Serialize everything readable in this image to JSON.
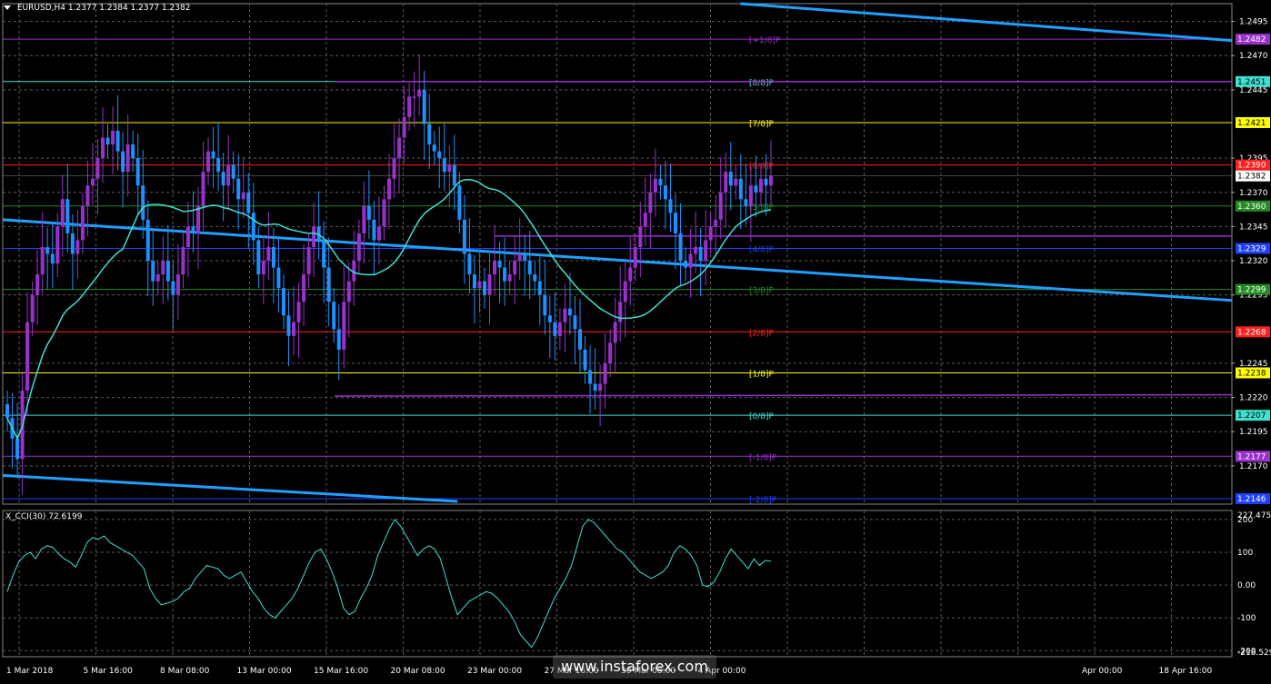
{
  "header": {
    "symbol": "EURUSD,H4",
    "ohlc": "1.2377 1.2384 1.2377 1.2382"
  },
  "indicator": {
    "title": "X_CCI(30) 72.6199",
    "ymax_label": "227.4755",
    "ymin_label": "-218.529"
  },
  "watermark": "www.instaforex.com",
  "colors": {
    "background": "#000000",
    "bull_candle": "#9932cc",
    "bear_candle": "#1e90ff",
    "ma_line": "#40e0d0",
    "trend_channel": "#1fa0ff",
    "cci_line": "#40e0d0",
    "grid": "#5a5a5a"
  },
  "chart_data": [
    {
      "type": "candlestick",
      "title": "EURUSD,H4",
      "x_tick_labels": [
        "1 Mar 2018",
        "5 Mar 16:00",
        "8 Mar 08:00",
        "13 Mar 00:00",
        "15 Mar 16:00",
        "20 Mar 08:00",
        "23 Mar 00:00",
        "27 Mar 16:00",
        "30 Mar 08:00",
        "4 Apr 00:00",
        "",
        "",
        "",
        "",
        "Apr 00:00",
        "18 Apr 16:00"
      ],
      "y_ticks": [
        1.2495,
        1.247,
        1.2445,
        1.2395,
        1.237,
        1.2345,
        1.232,
        1.2295,
        1.2245,
        1.222,
        1.2195,
        1.217
      ],
      "ylim": [
        1.2142,
        1.2508
      ],
      "current_price": 1.2382,
      "closes": [
        1.2205,
        1.219,
        1.2175,
        1.2225,
        1.2275,
        1.2295,
        1.231,
        1.233,
        1.2325,
        1.2318,
        1.2345,
        1.2365,
        1.234,
        1.2325,
        1.2335,
        1.236,
        1.2375,
        1.238,
        1.2395,
        1.241,
        1.2405,
        1.2415,
        1.24,
        1.2385,
        1.2405,
        1.2395,
        1.2375,
        1.235,
        1.232,
        1.2305,
        1.231,
        1.232,
        1.2305,
        1.2295,
        1.231,
        1.233,
        1.2345,
        1.234,
        1.236,
        1.2385,
        1.24,
        1.2395,
        1.2385,
        1.2375,
        1.239,
        1.238,
        1.2365,
        1.237,
        1.2355,
        1.2335,
        1.231,
        1.232,
        1.233,
        1.2315,
        1.23,
        1.228,
        1.2265,
        1.2275,
        1.229,
        1.231,
        1.233,
        1.2345,
        1.2335,
        1.2315,
        1.229,
        1.227,
        1.2255,
        1.229,
        1.2305,
        1.232,
        1.234,
        1.236,
        1.235,
        1.2335,
        1.2345,
        1.2365,
        1.238,
        1.2395,
        1.241,
        1.2425,
        1.244,
        1.244,
        1.2445,
        1.242,
        1.2405,
        1.24,
        1.2395,
        1.2385,
        1.239,
        1.2375,
        1.235,
        1.2325,
        1.231,
        1.23,
        1.2305,
        1.2295,
        1.231,
        1.232,
        1.2315,
        1.2305,
        1.231,
        1.232,
        1.2325,
        1.232,
        1.231,
        1.2305,
        1.2295,
        1.228,
        1.2275,
        1.2265,
        1.2275,
        1.2285,
        1.228,
        1.227,
        1.2255,
        1.224,
        1.223,
        1.2225,
        1.223,
        1.2245,
        1.226,
        1.2275,
        1.229,
        1.2305,
        1.2315,
        1.233,
        1.2345,
        1.2355,
        1.237,
        1.238,
        1.2375,
        1.2365,
        1.2355,
        1.234,
        1.232,
        1.2315,
        1.2325,
        1.233,
        1.232,
        1.2335,
        1.2345,
        1.235,
        1.237,
        1.2385,
        1.2375,
        1.238,
        1.2365,
        1.236,
        1.2375,
        1.237,
        1.238,
        1.2375,
        1.2382
      ],
      "ma_period": 24,
      "horizontal_levels": [
        {
          "label": "[+1/8]P",
          "price": 1.2482,
          "color": "#9932cc"
        },
        {
          "label": "[8/8]P",
          "price": 1.2451,
          "color": "#40e0d0"
        },
        {
          "label": "[7/8]P",
          "price": 1.2421,
          "color": "#ffff00"
        },
        {
          "label": "[6/8]P",
          "price": 1.239,
          "color": "#ff2020"
        },
        {
          "label": "[5/8]P",
          "price": 1.236,
          "color": "#228b22"
        },
        {
          "label": "[4/8]P",
          "price": 1.2329,
          "color": "#2040ff"
        },
        {
          "label": "[3/8]P",
          "price": 1.2299,
          "color": "#228b22"
        },
        {
          "label": "[2/8]P",
          "price": 1.2268,
          "color": "#ff2020"
        },
        {
          "label": "[1/8]P",
          "price": 1.2238,
          "color": "#ffff00"
        },
        {
          "label": "[0/8]P",
          "price": 1.2207,
          "color": "#40e0d0"
        },
        {
          "label": "[-1/8]P",
          "price": 1.2177,
          "color": "#9932cc"
        },
        {
          "label": "[-2/8]P",
          "price": 1.2146,
          "color": "#2040ff"
        }
      ],
      "level_price_labels": [
        "1.2482",
        "1.2451",
        "1.2421",
        "1.2390",
        "1.2360",
        "1.2329",
        "1.2299",
        "1.2268",
        "1.2238",
        "1.2207",
        "1.2177",
        "1.2146"
      ],
      "trend_lines": [
        {
          "from": [
            0,
            1.235
          ],
          "to": [
            1,
            1.2291
          ],
          "color": "#1fa0ff"
        },
        {
          "from": [
            0.6,
            1.2508
          ],
          "to": [
            1,
            1.2481
          ],
          "color": "#1fa0ff"
        },
        {
          "from": [
            0,
            1.2163
          ],
          "to": [
            0.37,
            1.2144
          ],
          "color": "#1fa0ff"
        },
        {
          "from": [
            0.27,
            1.2451
          ],
          "to": [
            1,
            1.2451
          ],
          "color": "#9932cc"
        },
        {
          "from": [
            0.27,
            1.2221
          ],
          "to": [
            1,
            1.2222
          ],
          "color": "#9932cc"
        },
        {
          "from": [
            0.4,
            1.2338
          ],
          "to": [
            1,
            1.2338
          ],
          "color": "#9932cc"
        }
      ]
    },
    {
      "type": "line",
      "title": "X_CCI(30) 72.6199",
      "y_ticks": [
        200,
        100,
        0.0,
        -100,
        -200
      ],
      "ylim": [
        -218.529,
        227.4755
      ],
      "values": [
        -20,
        30,
        70,
        90,
        100,
        80,
        110,
        120,
        115,
        95,
        80,
        70,
        55,
        90,
        130,
        145,
        140,
        150,
        130,
        120,
        110,
        100,
        90,
        70,
        50,
        -10,
        -40,
        -60,
        -55,
        -50,
        -40,
        -20,
        -10,
        20,
        40,
        60,
        55,
        50,
        30,
        20,
        30,
        40,
        10,
        -20,
        -40,
        -70,
        -90,
        -100,
        -80,
        -60,
        -40,
        -10,
        30,
        70,
        100,
        110,
        80,
        40,
        -10,
        -70,
        -90,
        -80,
        -40,
        -10,
        30,
        90,
        130,
        170,
        200,
        180,
        150,
        120,
        90,
        110,
        120,
        110,
        80,
        20,
        -40,
        -90,
        -70,
        -50,
        -40,
        -30,
        -20,
        -25,
        -40,
        -60,
        -80,
        -110,
        -150,
        -170,
        -190,
        -160,
        -120,
        -80,
        -40,
        -10,
        20,
        60,
        120,
        180,
        200,
        190,
        170,
        150,
        130,
        110,
        100,
        80,
        60,
        40,
        30,
        20,
        30,
        40,
        60,
        100,
        120,
        110,
        90,
        60,
        0,
        -5,
        10,
        40,
        80,
        110,
        90,
        70,
        50,
        80,
        60,
        75,
        72.6199
      ]
    }
  ]
}
